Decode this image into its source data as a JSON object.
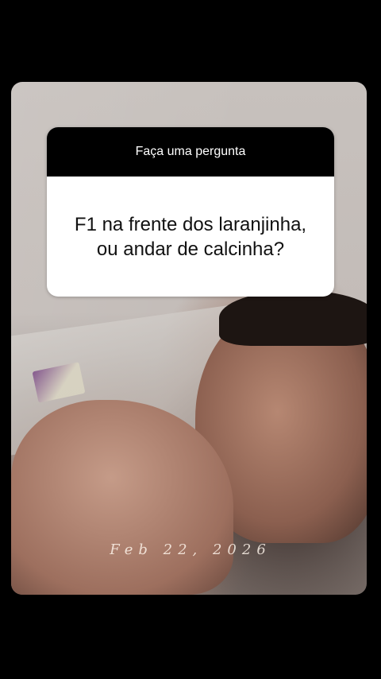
{
  "question_sticker": {
    "header": "Faça uma pergunta",
    "question": "F1 na frente dos laranjinha, ou andar de calcinha?"
  },
  "photo": {
    "date_stamp": "Feb 22, 2026"
  }
}
